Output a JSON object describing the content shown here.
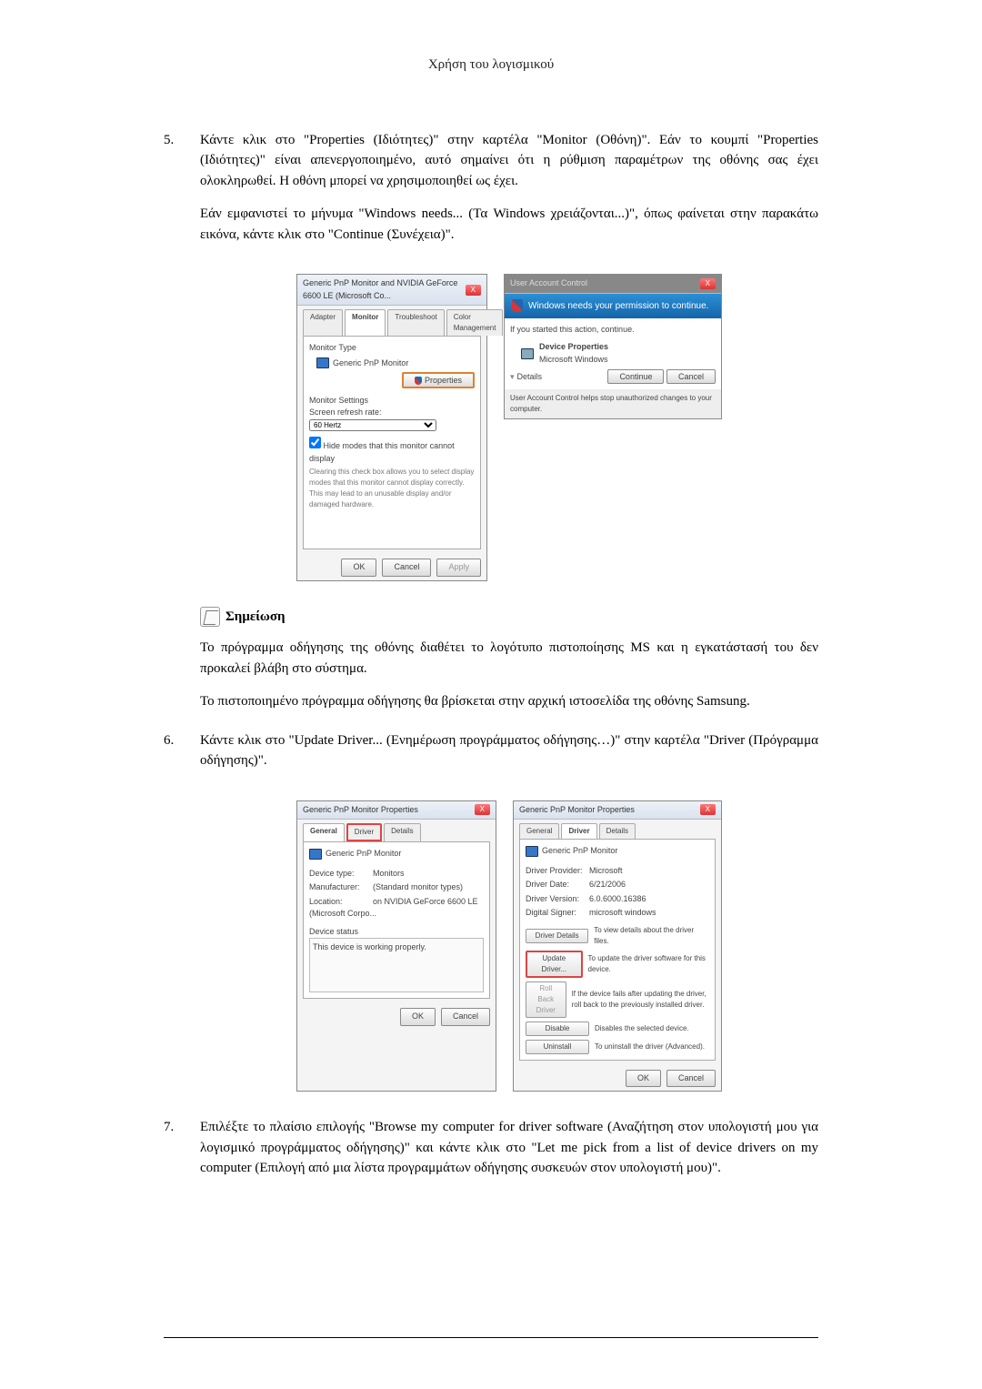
{
  "header_title": "Χρήση του λογισμικού",
  "step5": {
    "num": "5.",
    "text1": "Κάντε κλικ στο \"Properties (Ιδιότητες)\" στην καρτέλα \"Monitor (Οθόνη)\". Εάν το κουμπί \"Properties (Ιδιότητες)\" είναι απενεργοποιημένο, αυτό σημαίνει ότι η ρύθμιση παραμέτρων της οθόνης σας έχει ολοκληρωθεί. Η οθόνη μπορεί να χρησιμοποιηθεί ως έχει.",
    "text2": "Εάν εμφανιστεί το μήνυμα \"Windows needs... (Τα Windows χρειάζονται...)\", όπως φαίνεται στην παρακάτω εικόνα, κάντε κλικ στο \"Continue (Συνέχεια)\"."
  },
  "fig_monitor_props": {
    "title": "Generic PnP Monitor and NVIDIA GeForce 6600 LE (Microsoft Co...",
    "tabs": {
      "adapter": "Adapter",
      "monitor": "Monitor",
      "troubleshoot": "Troubleshoot",
      "color": "Color Management"
    },
    "monitor_type_label": "Monitor Type",
    "monitor_type_val": "Generic PnP Monitor",
    "properties_btn": "Properties",
    "settings_label": "Monitor Settings",
    "refresh_label": "Screen refresh rate:",
    "refresh_val": "60 Hertz",
    "hide_modes_check": "Hide modes that this monitor cannot display",
    "hide_modes_desc": "Clearing this check box allows you to select display modes that this monitor cannot display correctly. This may lead to an unusable display and/or damaged hardware.",
    "ok": "OK",
    "cancel": "Cancel",
    "apply": "Apply"
  },
  "fig_uac": {
    "title": "User Account Control",
    "banner": "Windows needs your permission to continue.",
    "line1": "If you started this action, continue.",
    "prog_name": "Device Properties",
    "prog_pub": "Microsoft Windows",
    "details_btn": "Details",
    "continue_btn": "Continue",
    "cancel_btn": "Cancel",
    "footer": "User Account Control helps stop unauthorized changes to your computer."
  },
  "note": {
    "heading": "Σημείωση",
    "text1": "Το πρόγραμμα οδήγησης της οθόνης διαθέτει το λογότυπο πιστοποίησης MS και η εγκατάστασή του δεν προκαλεί βλάβη στο σύστημα.",
    "text2": "Το πιστοποιημένο πρόγραμμα οδήγησης θα βρίσκεται στην αρχική ιστοσελίδα της οθόνης Samsung."
  },
  "step6": {
    "num": "6.",
    "text": "Κάντε κλικ στο \"Update Driver... (Ενημέρωση προγράμματος οδήγησης…)\" στην καρτέλα \"Driver (Πρόγραμμα οδήγησης)\"."
  },
  "fig_driver_general": {
    "title": "Generic PnP Monitor Properties",
    "tabs": {
      "general": "General",
      "driver": "Driver",
      "details": "Details"
    },
    "device_name": "Generic PnP Monitor",
    "rows": {
      "type_lbl": "Device type:",
      "type_val": "Monitors",
      "mfg_lbl": "Manufacturer:",
      "mfg_val": "(Standard monitor types)",
      "loc_lbl": "Location:",
      "loc_val": "on NVIDIA GeForce 6600 LE (Microsoft Corpo..."
    },
    "status_lbl": "Device status",
    "status_val": "This device is working properly.",
    "ok": "OK",
    "cancel": "Cancel"
  },
  "fig_driver_tab": {
    "title": "Generic PnP Monitor Properties",
    "tabs": {
      "general": "General",
      "driver": "Driver",
      "details": "Details"
    },
    "device_name": "Generic PnP Monitor",
    "rows": {
      "prov_lbl": "Driver Provider:",
      "prov_val": "Microsoft",
      "date_lbl": "Driver Date:",
      "date_val": "6/21/2006",
      "ver_lbl": "Driver Version:",
      "ver_val": "6.0.6000.16386",
      "sign_lbl": "Digital Signer:",
      "sign_val": "microsoft windows"
    },
    "btns": {
      "details": "Driver Details",
      "details_desc": "To view details about the driver files.",
      "update": "Update Driver...",
      "update_desc": "To update the driver software for this device.",
      "rollback": "Roll Back Driver",
      "rollback_desc": "If the device fails after updating the driver, roll back to the previously installed driver.",
      "disable": "Disable",
      "disable_desc": "Disables the selected device.",
      "uninstall": "Uninstall",
      "uninstall_desc": "To uninstall the driver (Advanced)."
    },
    "ok": "OK",
    "cancel": "Cancel"
  },
  "step7": {
    "num": "7.",
    "text": "Επιλέξτε το πλαίσιο επιλογής \"Browse my computer for driver software (Αναζήτηση στον υπολογιστή μου για λογισμικό προγράμματος οδήγησης)\" και κάντε κλικ στο \"Let me pick from a list of device drivers on my computer (Επιλογή από μια λίστα προγραμμάτων οδήγησης συσκευών στον υπολογιστή μου)\"."
  }
}
